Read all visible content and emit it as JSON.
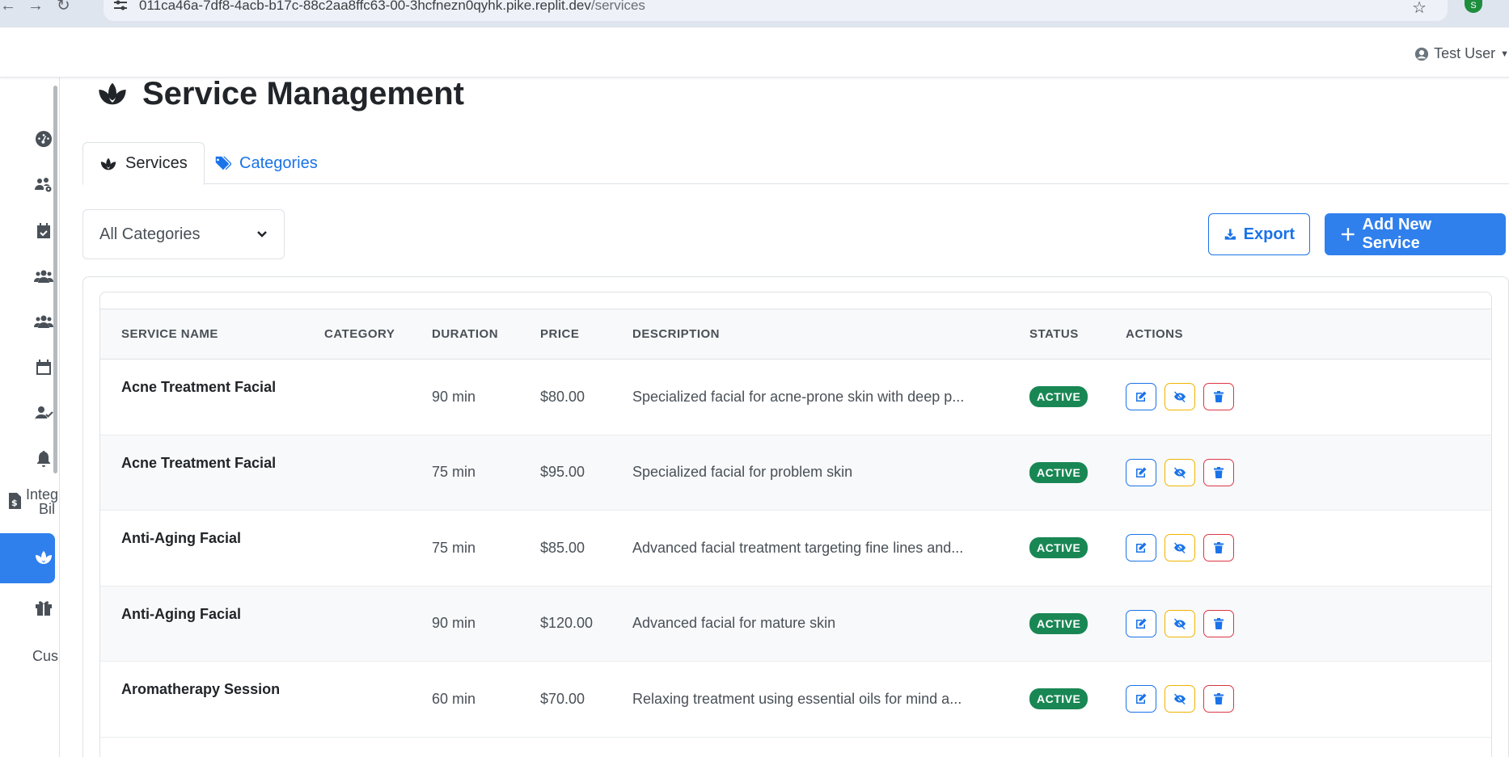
{
  "browser": {
    "url_host": "011ca46a-7df8-4acb-b17c-88c2aa8ffc63-00-3hcfnezn0qyhk.pike.replit.dev",
    "url_path": "/services",
    "profile_initial": "S"
  },
  "header": {
    "user_name": "Test User"
  },
  "sidebar": {
    "partial_labels": [
      "Integ",
      "Bil",
      "Cus"
    ]
  },
  "page": {
    "title": "Service Management"
  },
  "tabs": [
    {
      "label": "Services",
      "active": true
    },
    {
      "label": "Categories",
      "active": false
    }
  ],
  "filter": {
    "selected": "All Categories"
  },
  "buttons": {
    "export": "Export",
    "add_service": "Add New Service"
  },
  "table": {
    "columns": [
      "SERVICE NAME",
      "CATEGORY",
      "DURATION",
      "PRICE",
      "DESCRIPTION",
      "STATUS",
      "ACTIONS"
    ],
    "rows": [
      {
        "name": "Acne Treatment Facial",
        "category": "",
        "duration": "90 min",
        "price": "$80.00",
        "description": "Specialized facial for acne-prone skin with deep p...",
        "status": "ACTIVE"
      },
      {
        "name": "Acne Treatment Facial",
        "category": "",
        "duration": "75 min",
        "price": "$95.00",
        "description": "Specialized facial for problem skin",
        "status": "ACTIVE"
      },
      {
        "name": "Anti-Aging Facial",
        "category": "",
        "duration": "75 min",
        "price": "$85.00",
        "description": "Advanced facial treatment targeting fine lines and...",
        "status": "ACTIVE"
      },
      {
        "name": "Anti-Aging Facial",
        "category": "",
        "duration": "90 min",
        "price": "$120.00",
        "description": "Advanced facial for mature skin",
        "status": "ACTIVE"
      },
      {
        "name": "Aromatherapy Session",
        "category": "",
        "duration": "60 min",
        "price": "$70.00",
        "description": "Relaxing treatment using essential oils for mind a...",
        "status": "ACTIVE"
      }
    ]
  },
  "colors": {
    "primary": "#2f80ed",
    "active_badge": "#198754",
    "warning": "#f0b400",
    "danger": "#dc3545"
  }
}
